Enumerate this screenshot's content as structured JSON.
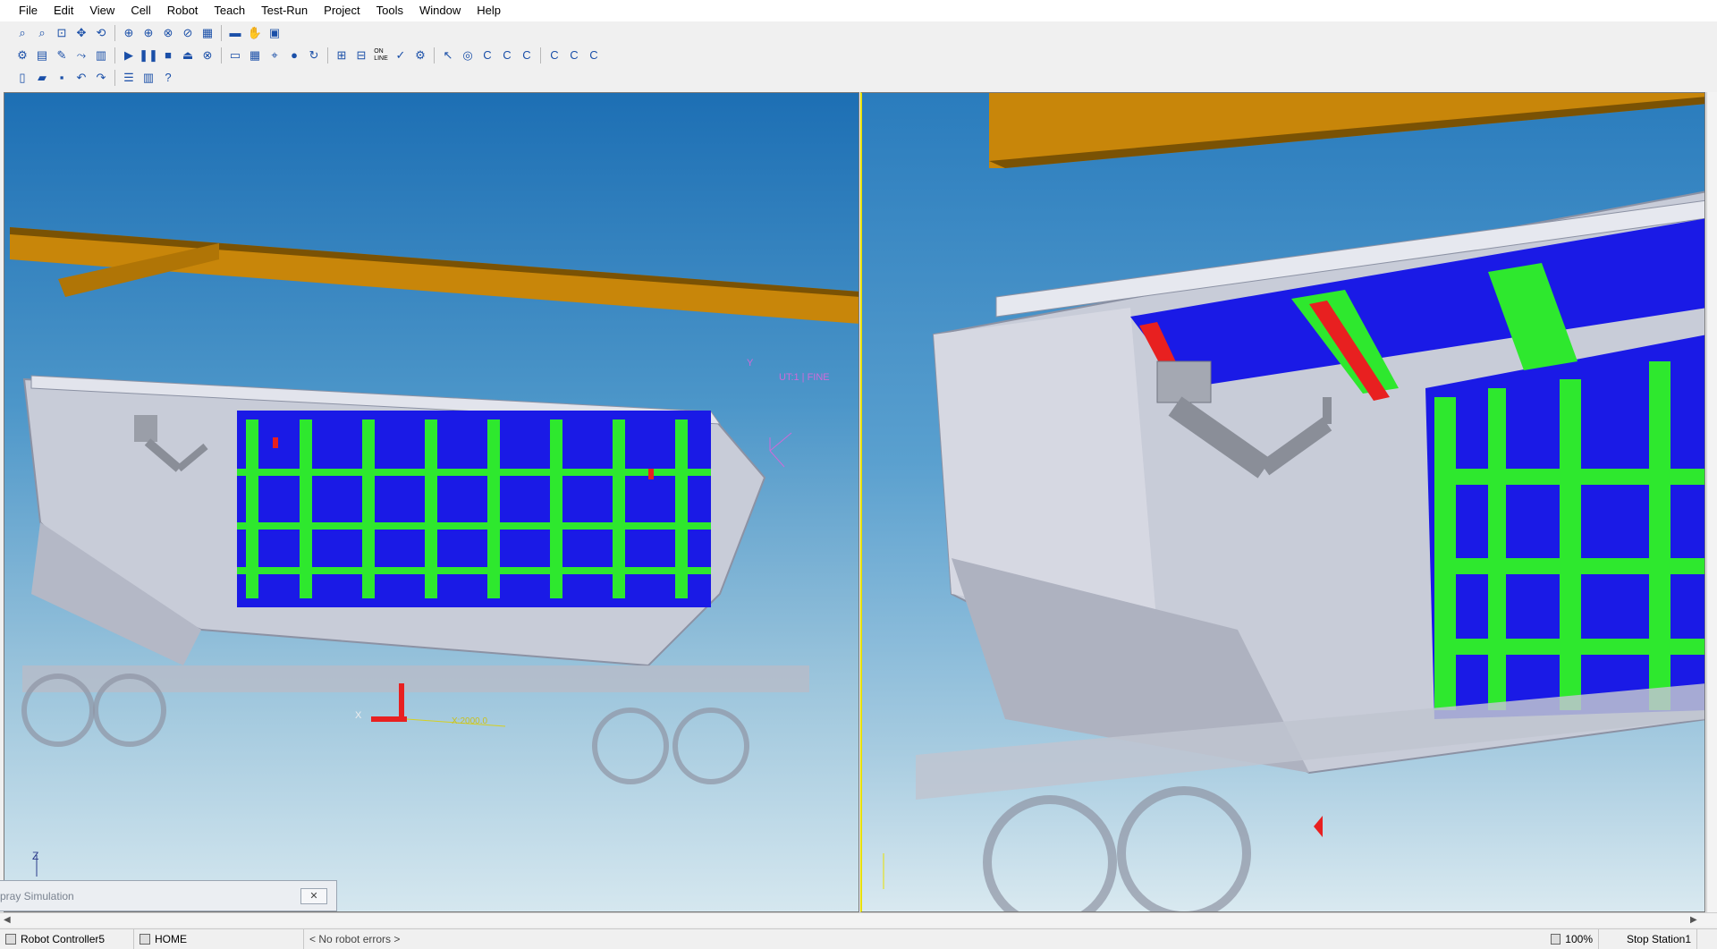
{
  "menu": [
    "File",
    "Edit",
    "View",
    "Cell",
    "Robot",
    "Teach",
    "Test-Run",
    "Project",
    "Tools",
    "Window",
    "Help"
  ],
  "toolbar_icons": {
    "row1": [
      "zoom-icon",
      "zoom-window-icon",
      "zoom-fit-icon",
      "move-icon",
      "rotate-view-icon",
      "frame-icon",
      "frame-all-icon",
      "frame-reset-icon",
      "frame-toggle-icon",
      "mesh-icon",
      "ruler-icon",
      "hand-icon",
      "camera-icon"
    ],
    "row2": [
      "robot-icon",
      "program-icon",
      "teach-icon",
      "path-icon",
      "cell-icon",
      "play-icon",
      "pause-icon",
      "stop-icon",
      "eject-icon",
      "cancel-icon",
      "record-icon",
      "grid-icon",
      "coords-icon",
      "paint-icon",
      "refresh-icon",
      "measure-icon",
      "measure2-icon",
      "online-icon",
      "check-icon",
      "settings-icon",
      "cursor-icon",
      "target-icon",
      "c-icon",
      "c-left-icon",
      "c-rotate-icon",
      "c-1x-icon",
      "c-2x-icon",
      "c-4x-icon"
    ],
    "row3": [
      "new-icon",
      "open-icon",
      "save-icon",
      "undo-icon",
      "redo-icon",
      "tree-icon",
      "chart-icon",
      "help-icon"
    ]
  },
  "online_label": "ON\nLINE",
  "viewport": {
    "tag_label": "UT:1 | FINE",
    "axis_z": "Z",
    "axis_y": "Y",
    "axis_x": "X",
    "coord_label": "X:2000.0"
  },
  "spray_window": {
    "title": "pray Simulation",
    "close_label": "✕"
  },
  "status": {
    "controller": "Robot Controller5",
    "mode": "HOME",
    "errors": "< No robot errors >",
    "zoom": "100%",
    "station": "Stop Station1"
  },
  "colors": {
    "beam": "#c8860a",
    "coating_blue": "#1a1ae6",
    "coating_green": "#2ee82e",
    "coating_red": "#e82020",
    "car_body": "#c8ccd8",
    "split_line": "#e8e000"
  }
}
